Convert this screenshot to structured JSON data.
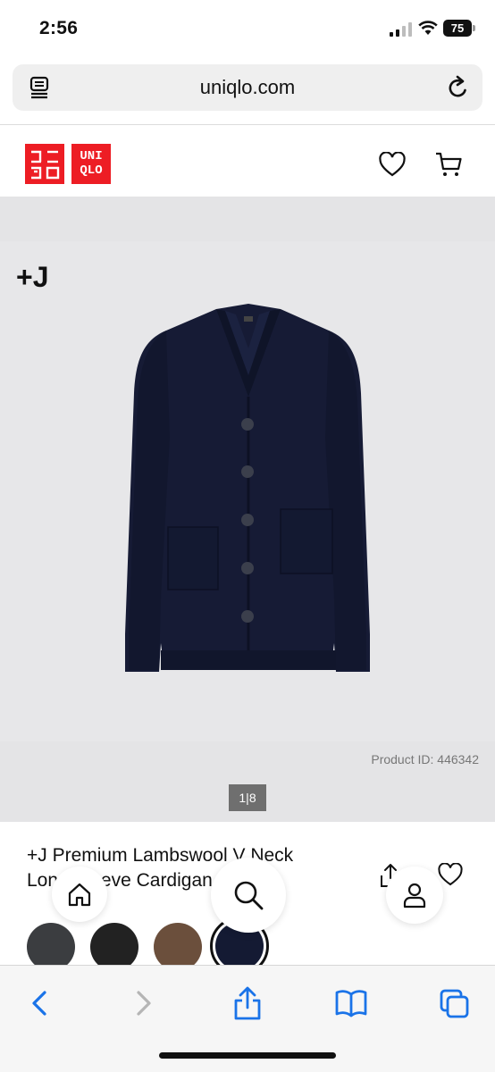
{
  "status": {
    "time": "2:56",
    "battery": "75"
  },
  "browser": {
    "url": "uniqlo.com"
  },
  "brand": {
    "logo_left": "ユニ\nクロ",
    "logo_right": "UNI\nQLO",
    "accent": "#ed1d24"
  },
  "product": {
    "badge": "+J",
    "id_text": "Product ID: 446342",
    "pager": "1|8",
    "title": "+J Premium Lambswool V Neck Long Sleeve Cardigan",
    "title_visible_line1": "+J Premium Lambswool V Neck",
    "title_visible_line2": "Long Sleeve Cardigan"
  },
  "swatches": [
    {
      "name": "dark-gray",
      "color": "#3b3d40"
    },
    {
      "name": "black",
      "color": "#222222"
    },
    {
      "name": "brown",
      "color": "#6b4f3c"
    },
    {
      "name": "navy",
      "color": "#141a33",
      "selected": true
    }
  ],
  "icons": {
    "reader": "reader-mode-icon",
    "reload": "reload-icon",
    "wishlist": "heart-icon",
    "cart": "cart-icon",
    "share": "share-icon",
    "home": "home-icon",
    "search": "search-icon",
    "account": "account-icon",
    "back": "back-icon",
    "forward": "forward-icon",
    "bookmarks": "bookmarks-icon",
    "tabs": "tabs-icon"
  }
}
